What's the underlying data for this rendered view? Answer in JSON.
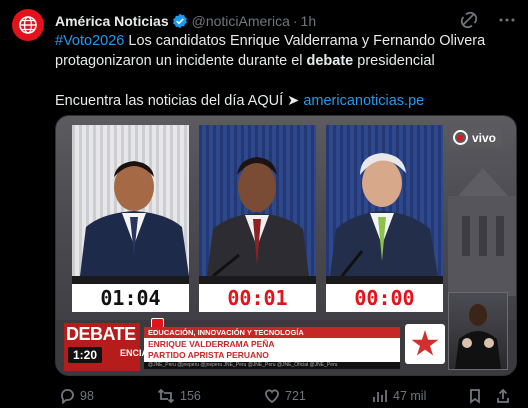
{
  "tweet": {
    "author_name": "América Noticias",
    "handle": "@noticiAmerica",
    "separator": "·",
    "time": "1h",
    "text_hashtag": "#Voto2026",
    "text_part1": " Los candidatos Enrique Valderrama y Fernando Olivera",
    "text_part2": "protagonizaron un incidente durante el ",
    "text_bold": "debate",
    "text_part3": " presidencial",
    "text_line3": "Encuentra las noticias del día AQUÍ ➤ ",
    "link_text": "americanoticias.pe"
  },
  "media": {
    "timers": [
      "01:04",
      "00:01",
      "00:00"
    ],
    "live_label": "vivo",
    "debate_label": "DEBATE",
    "debate_sub": "ENCIAL",
    "clock": "1:20",
    "topic": "EDUCACIÓN, INNOVACIÓN Y TECNOLOGÍA",
    "speaker_name": "ENRIQUE VALDERRAMA PEÑA",
    "speaker_party": "PARTIDO APRISTA PERUANO",
    "social_handles": "@JNE_Peru   @jneperu   @jneperu   JNE_Peru   @JNE_Peru   @JNE_Oficial   @JNE_Peru"
  },
  "actions": {
    "replies": "98",
    "reposts": "156",
    "likes": "721",
    "views": "47 mil"
  },
  "colors": {
    "background": "#000000",
    "text": "#e7e9ea",
    "muted": "#71767b",
    "link": "#1d9bf0",
    "brand_red": "#e3121b",
    "verified": "#1d9bf0"
  },
  "icons": [
    "americanoticias-avatar-icon",
    "verified-badge-icon",
    "grok-icon",
    "more-icon",
    "reply-icon",
    "repost-icon",
    "like-icon",
    "views-icon",
    "bookmark-icon",
    "share-icon",
    "live-icon",
    "apra-star-icon"
  ]
}
